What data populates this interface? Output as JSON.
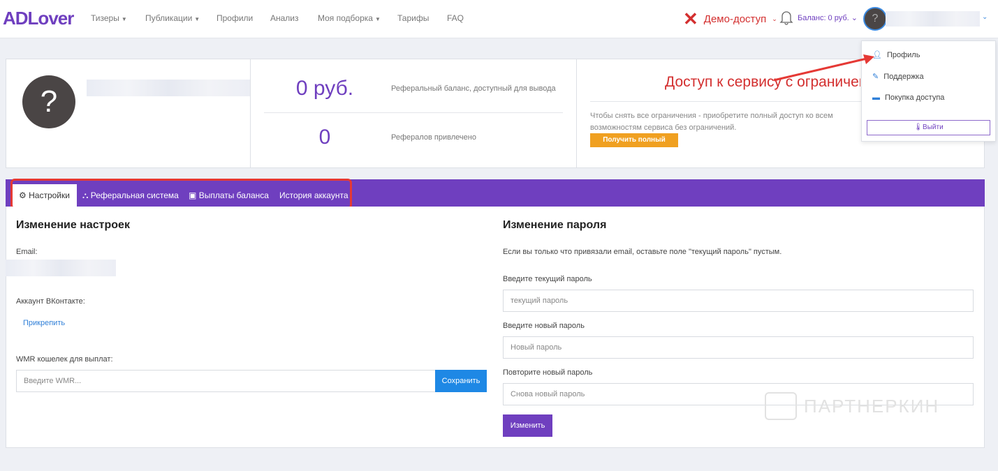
{
  "nav": {
    "logo": "ADLover",
    "items": [
      {
        "label": "Тизеры",
        "caret": true
      },
      {
        "label": "Публикации",
        "caret": true
      },
      {
        "label": "Профили",
        "caret": false
      },
      {
        "label": "Анализ",
        "caret": false
      },
      {
        "label": "Моя подборка",
        "caret": true
      },
      {
        "label": "Тарифы",
        "caret": false
      },
      {
        "label": "FAQ",
        "caret": false
      }
    ],
    "demo_label": "Демо-доступ",
    "balance_label": "Баланс: 0 руб."
  },
  "user_menu": {
    "items": [
      {
        "label": "Профиль",
        "icon": "user-icon"
      },
      {
        "label": "Поддержка",
        "icon": "edit-icon"
      },
      {
        "label": "Покупка доступа",
        "icon": "credit-card-icon"
      }
    ],
    "logout_label": "Выйти"
  },
  "profile": {
    "avatar_glyph": "?",
    "balance_value": "0 руб.",
    "balance_label": "Реферальный баланс, доступный для вывода",
    "referrals_value": "0",
    "referrals_label": "Рефералов привлечено"
  },
  "access": {
    "title": "Доступ к сервису с ограничениями",
    "text": "Чтобы снять все ограничения - приобретите полный доступ ко всем возможностям сервиса без ограничений.",
    "button": "Получить полный доступ"
  },
  "tabs": [
    {
      "label": "Настройки",
      "icon": "gear-icon"
    },
    {
      "label": "Реферальная система",
      "icon": "sitemap-icon"
    },
    {
      "label": "Выплаты баланса",
      "icon": "money-icon"
    },
    {
      "label": "История аккаунта",
      "icon": ""
    }
  ],
  "settings": {
    "title": "Изменение настроек",
    "email_label": "Email:",
    "vk_label": "Аккаунт ВКонтакте:",
    "vk_link": "Прикрепить",
    "wmr_label": "WMR кошелек для выплат:",
    "wmr_placeholder": "Введите WMR...",
    "save": "Сохранить"
  },
  "password": {
    "title": "Изменение пароля",
    "note": "Если вы только что привязали email, оставьте поле \"текущий пароль\" пустым.",
    "current_label": "Введите текущий пароль",
    "current_placeholder": "текущий пароль",
    "new_label": "Введите новый пароль",
    "new_placeholder": "Новый пароль",
    "repeat_label": "Повторите новый пароль",
    "repeat_placeholder": "Снова новый пароль",
    "submit": "Изменить"
  },
  "watermark": "ПАРТНЕРКИН",
  "colors": {
    "brand": "#6f3fbf",
    "danger": "#d32f2f",
    "accent": "#1e88e5",
    "orange": "#f0a020"
  }
}
